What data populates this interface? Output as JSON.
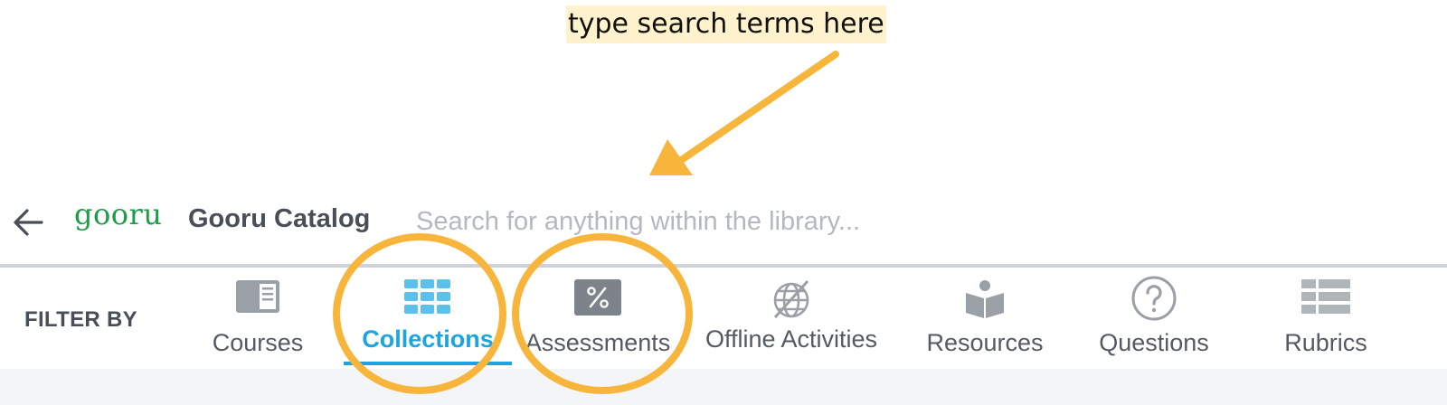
{
  "annotation": {
    "callout_text": "type search terms here",
    "highlight_color": "#fff2cc",
    "marker_color": "#f8b53c"
  },
  "header": {
    "back_icon": "arrow-left-icon",
    "logo_text": "gooru",
    "catalog_title": "Gooru Catalog",
    "search_placeholder": "Search for anything within the library...",
    "search_value": ""
  },
  "filter_bar": {
    "label": "FILTER BY",
    "active_color": "#1ba5e0",
    "tabs": [
      {
        "id": "courses",
        "label": "Courses",
        "icon": "book-icon",
        "active": false
      },
      {
        "id": "collections",
        "label": "Collections",
        "icon": "grid-icon",
        "active": true
      },
      {
        "id": "assessments",
        "label": "Assessments",
        "icon": "percent-icon",
        "active": false
      },
      {
        "id": "offline-activities",
        "label": "Offline Activities",
        "icon": "no-globe-icon",
        "active": false
      },
      {
        "id": "resources",
        "label": "Resources",
        "icon": "reader-icon",
        "active": false
      },
      {
        "id": "questions",
        "label": "Questions",
        "icon": "question-circle-icon",
        "active": false
      },
      {
        "id": "rubrics",
        "label": "Rubrics",
        "icon": "table-icon",
        "active": false
      }
    ]
  }
}
